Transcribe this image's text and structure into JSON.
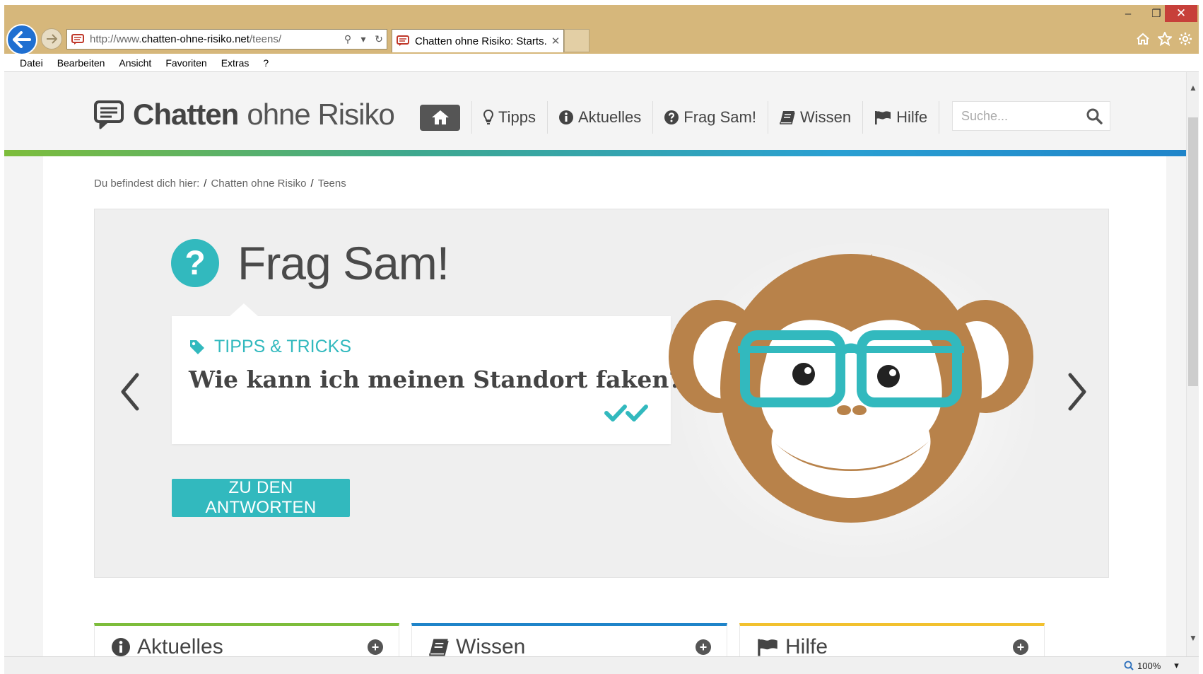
{
  "browser": {
    "url_prefix": "http://www.",
    "url_domain": "chatten-ohne-risiko.net",
    "url_path": "/teens/",
    "tab_title": "Chatten ohne Risiko: Starts...",
    "menu": [
      "Datei",
      "Bearbeiten",
      "Ansicht",
      "Favoriten",
      "Extras",
      "?"
    ],
    "zoom": "100%"
  },
  "site": {
    "logo_bold": "Chatten",
    "logo_thin": "ohne Risiko",
    "nav": {
      "tipps": "Tipps",
      "aktuelles": "Aktuelles",
      "fragsam": "Frag Sam!",
      "wissen": "Wissen",
      "hilfe": "Hilfe"
    },
    "search_placeholder": "Suche..."
  },
  "breadcrumb": {
    "label": "Du befindest dich hier:",
    "items": [
      "Chatten ohne Risiko",
      "Teens"
    ]
  },
  "hero": {
    "title": "Frag Sam!",
    "tag": "TIPPS & TRICKS",
    "question": "Wie kann ich meinen Standort faken?",
    "cta": "ZU DEN ANTWORTEN"
  },
  "panels": [
    {
      "title": "Aktuelles",
      "color": "#7dbd3b"
    },
    {
      "title": "Wissen",
      "color": "#1f84c9"
    },
    {
      "title": "Hilfe",
      "color": "#f2c12e"
    }
  ],
  "colors": {
    "accent": "#32b9be",
    "chrome": "#d6b77b",
    "back_button": "#1f6fd1",
    "close_button": "#c7403a"
  }
}
